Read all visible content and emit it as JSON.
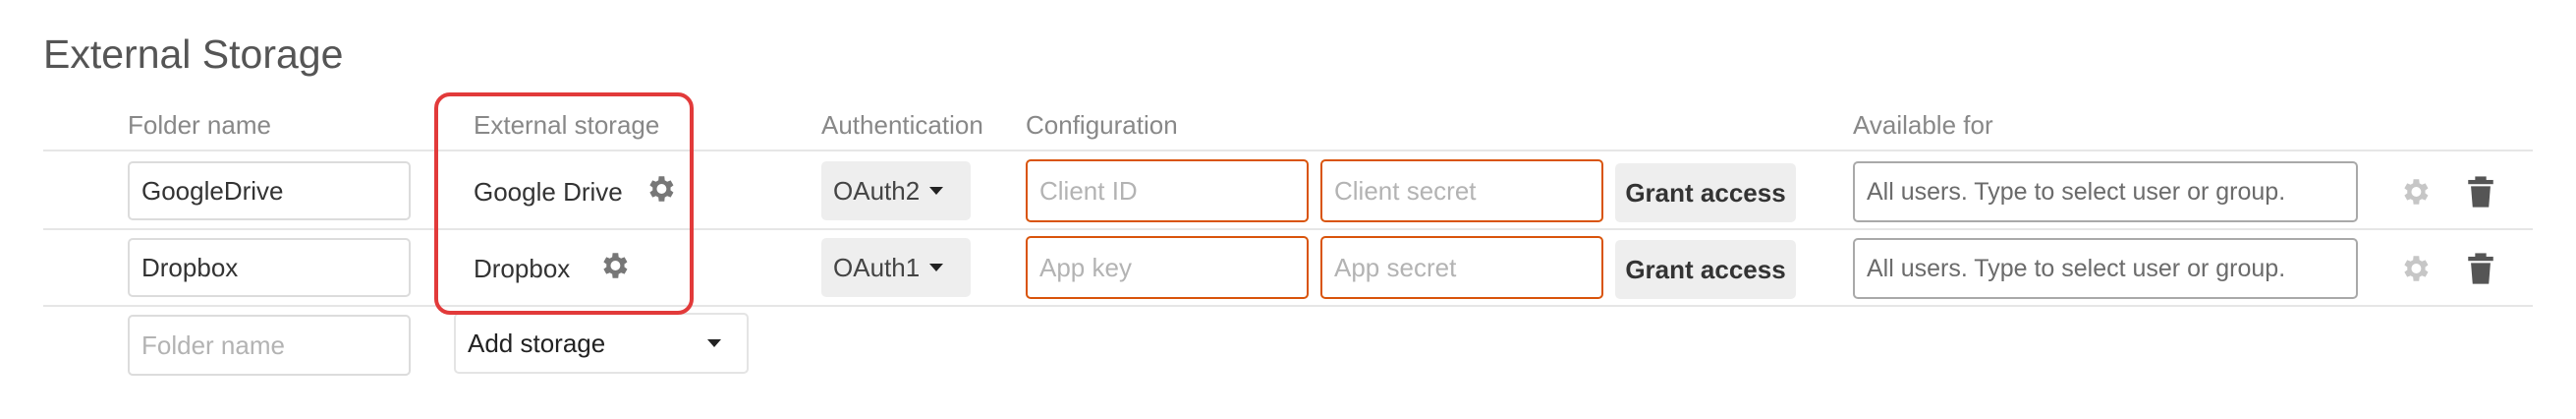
{
  "page": {
    "title": "External Storage"
  },
  "headers": {
    "folder_name": "Folder name",
    "external_storage": "External storage",
    "authentication": "Authentication",
    "configuration": "Configuration",
    "available_for": "Available for"
  },
  "rows": [
    {
      "folder_name": "GoogleDrive",
      "storage": "Google Drive",
      "auth": "OAuth2",
      "config1_placeholder": "Client ID",
      "config2_placeholder": "Client secret",
      "grant_label": "Grant access",
      "available_placeholder": "All users. Type to select user or group."
    },
    {
      "folder_name": "Dropbox",
      "storage": "Dropbox",
      "auth": "OAuth1",
      "config1_placeholder": "App key",
      "config2_placeholder": "App secret",
      "grant_label": "Grant access",
      "available_placeholder": "All users. Type to select user or group."
    }
  ],
  "new_row": {
    "folder_placeholder": "Folder name",
    "add_storage_label": "Add storage"
  },
  "icons": {
    "settings": "gear-icon",
    "delete": "trash-icon",
    "dropdown": "chevron-down-icon"
  },
  "colors": {
    "required_border": "#d9540b",
    "highlight": "#e23a3a"
  }
}
